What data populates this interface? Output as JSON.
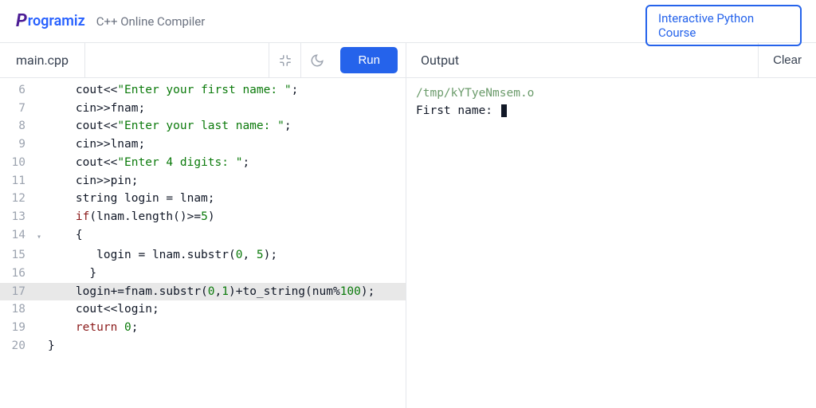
{
  "header": {
    "brand": "rogramiz",
    "title": "C++ Online Compiler",
    "promo_line1": "Interactive Python",
    "promo_line2": "Course"
  },
  "editor": {
    "filename": "main.cpp",
    "run_label": "Run",
    "lines": [
      {
        "n": 6,
        "fold": "",
        "hl": false,
        "tokens": [
          {
            "t": "    cout<<",
            "c": ""
          },
          {
            "t": "\"Enter your first name: \"",
            "c": "str"
          },
          {
            "t": ";",
            "c": ""
          }
        ]
      },
      {
        "n": 7,
        "fold": "",
        "hl": false,
        "tokens": [
          {
            "t": "    cin>>fnam;",
            "c": ""
          }
        ]
      },
      {
        "n": 8,
        "fold": "",
        "hl": false,
        "tokens": [
          {
            "t": "    cout<<",
            "c": ""
          },
          {
            "t": "\"Enter your last name: \"",
            "c": "str"
          },
          {
            "t": ";",
            "c": ""
          }
        ]
      },
      {
        "n": 9,
        "fold": "",
        "hl": false,
        "tokens": [
          {
            "t": "    cin>>lnam;",
            "c": ""
          }
        ]
      },
      {
        "n": 10,
        "fold": "",
        "hl": false,
        "tokens": [
          {
            "t": "    cout<<",
            "c": ""
          },
          {
            "t": "\"Enter 4 digits: \"",
            "c": "str"
          },
          {
            "t": ";",
            "c": ""
          }
        ]
      },
      {
        "n": 11,
        "fold": "",
        "hl": false,
        "tokens": [
          {
            "t": "    cin>>pin;",
            "c": ""
          }
        ]
      },
      {
        "n": 12,
        "fold": "",
        "hl": false,
        "tokens": [
          {
            "t": "    string login = lnam;",
            "c": ""
          }
        ]
      },
      {
        "n": 13,
        "fold": "",
        "hl": false,
        "tokens": [
          {
            "t": "    ",
            "c": ""
          },
          {
            "t": "if",
            "c": "kw"
          },
          {
            "t": "(lnam.length()>=",
            "c": ""
          },
          {
            "t": "5",
            "c": "num"
          },
          {
            "t": ")",
            "c": ""
          }
        ]
      },
      {
        "n": 14,
        "fold": "▾",
        "hl": false,
        "tokens": [
          {
            "t": "    {",
            "c": ""
          }
        ]
      },
      {
        "n": 15,
        "fold": "",
        "hl": false,
        "tokens": [
          {
            "t": "       login = lnam.substr(",
            "c": ""
          },
          {
            "t": "0",
            "c": "num"
          },
          {
            "t": ", ",
            "c": ""
          },
          {
            "t": "5",
            "c": "num"
          },
          {
            "t": ");",
            "c": ""
          }
        ]
      },
      {
        "n": 16,
        "fold": "",
        "hl": false,
        "tokens": [
          {
            "t": "      }",
            "c": ""
          }
        ]
      },
      {
        "n": 17,
        "fold": "",
        "hl": true,
        "tokens": [
          {
            "t": "    login+=fnam.substr(",
            "c": ""
          },
          {
            "t": "0",
            "c": "num"
          },
          {
            "t": ",",
            "c": ""
          },
          {
            "t": "1",
            "c": "num"
          },
          {
            "t": ")+to_string(num%",
            "c": ""
          },
          {
            "t": "100",
            "c": "num"
          },
          {
            "t": ");",
            "c": ""
          }
        ]
      },
      {
        "n": 18,
        "fold": "",
        "hl": false,
        "tokens": [
          {
            "t": "    cout<<login;",
            "c": ""
          }
        ]
      },
      {
        "n": 19,
        "fold": "",
        "hl": false,
        "tokens": [
          {
            "t": "    ",
            "c": ""
          },
          {
            "t": "return",
            "c": "kw"
          },
          {
            "t": " ",
            "c": ""
          },
          {
            "t": "0",
            "c": "num"
          },
          {
            "t": ";",
            "c": ""
          }
        ]
      },
      {
        "n": 20,
        "fold": "",
        "hl": false,
        "tokens": [
          {
            "t": "}",
            "c": ""
          }
        ]
      }
    ]
  },
  "output": {
    "label": "Output",
    "clear_label": "Clear",
    "line1": "/tmp/kYTyeNmsem.o",
    "line2": "First name: "
  }
}
